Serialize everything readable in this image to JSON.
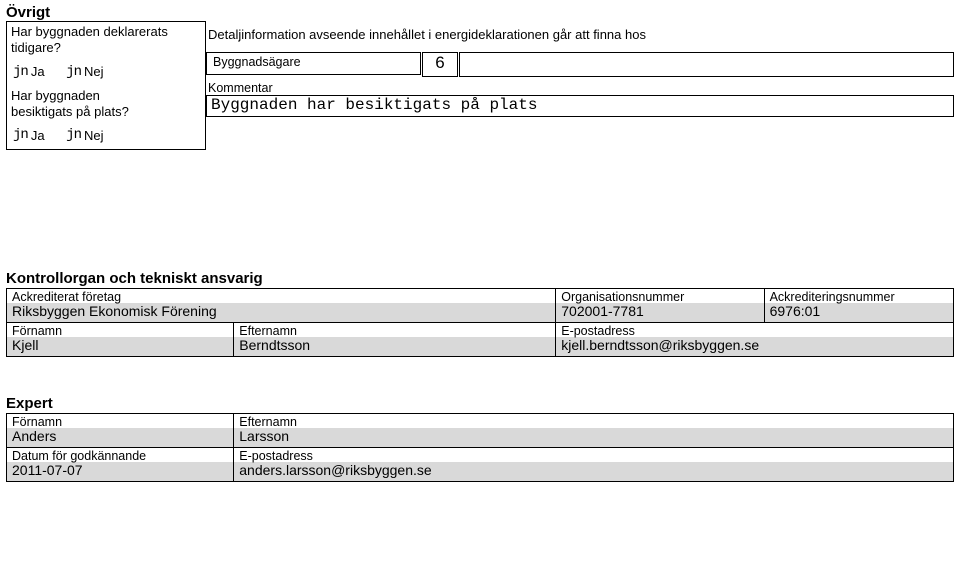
{
  "ovrigt": {
    "heading": "Övrigt",
    "q1": "Har byggnaden deklarerats tidigare?",
    "q2_line1": "Har byggnaden",
    "q2_line2": "besiktigats på plats?",
    "ja": "Ja",
    "nej": "Nej",
    "radio_glyph": "jn",
    "detail_text": "Detaljinformation avseende innehållet i energideklarationen går att finna hos",
    "byggnadsagare_label": "Byggnadsägare",
    "byggnadsagare_count": "6",
    "kommentar_label": "Kommentar",
    "kommentar_value": "Byggnaden har besiktigats på plats"
  },
  "kontroll": {
    "heading": "Kontrollorgan och tekniskt ansvarig",
    "ack_label": "Ackrediterat företag",
    "ack_value": "Riksbyggen Ekonomisk Förening",
    "org_label": "Organisationsnummer",
    "org_value": "702001-7781",
    "acknr_label": "Ackrediteringsnummer",
    "acknr_value": "6976:01",
    "fornamn_label": "Förnamn",
    "fornamn_value": "Kjell",
    "efternamn_label": "Efternamn",
    "efternamn_value": "Berndtsson",
    "epost_label": "E-postadress",
    "epost_value": "kjell.berndtsson@riksbyggen.se"
  },
  "expert": {
    "heading": "Expert",
    "fornamn_label": "Förnamn",
    "fornamn_value": "Anders",
    "efternamn_label": "Efternamn",
    "efternamn_value": "Larsson",
    "datum_label": "Datum för godkännande",
    "datum_value": "2011-07-07",
    "epost_label": "E-postadress",
    "epost_value": "anders.larsson@riksbyggen.se"
  }
}
